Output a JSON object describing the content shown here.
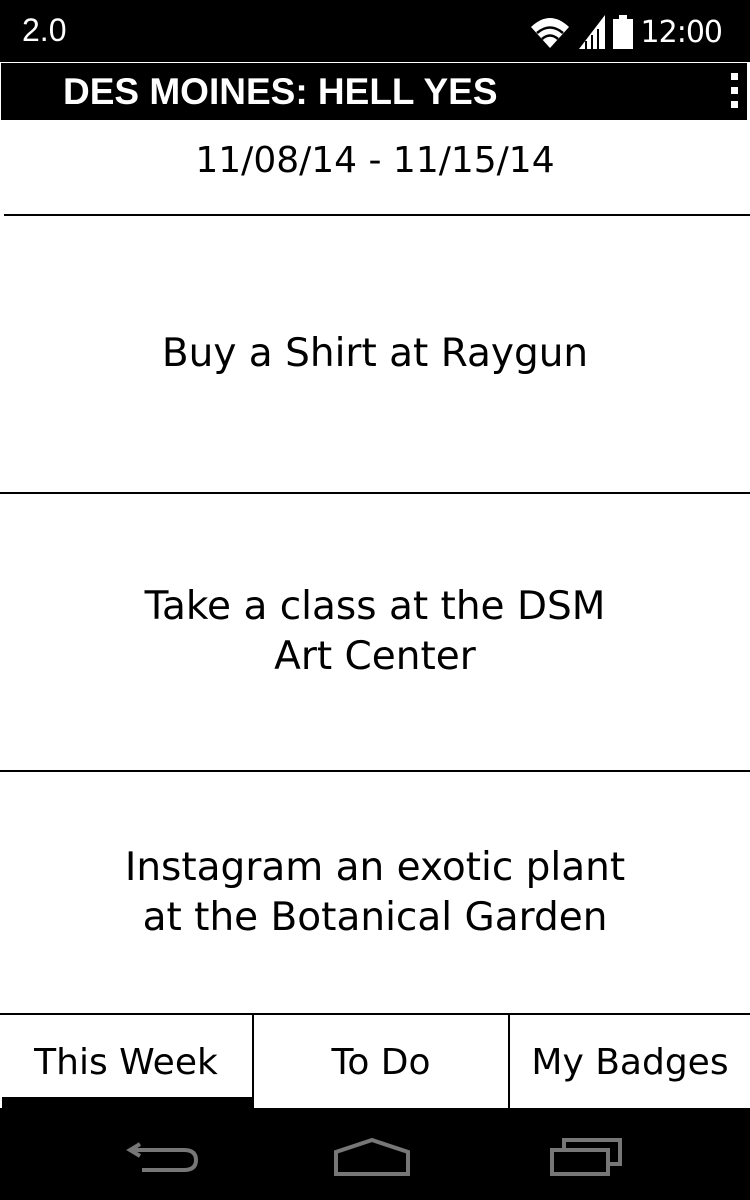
{
  "status_bar": {
    "version": "2.0",
    "time": "12:00",
    "icons": [
      "wifi-icon",
      "signal-icon",
      "battery-icon"
    ]
  },
  "app_bar": {
    "title": "DES MOINES: HELL YES",
    "overflow_icon": "overflow-menu-icon"
  },
  "date_range": "11/08/14 - 11/15/14",
  "items": [
    {
      "label": "Buy a Shirt at Raygun"
    },
    {
      "label": "Take a class at the DSM Art Center"
    },
    {
      "label": "Instagram an exotic plant at the Botanical Garden"
    }
  ],
  "tabs": [
    {
      "label": "This Week",
      "active": true
    },
    {
      "label": "To Do",
      "active": false
    },
    {
      "label": "My Badges",
      "active": false
    }
  ],
  "nav_bar": {
    "icons": [
      "back-icon",
      "home-icon",
      "recents-icon"
    ]
  },
  "colors": {
    "bar": "#000000",
    "background": "#ffffff",
    "text": "#000000"
  }
}
